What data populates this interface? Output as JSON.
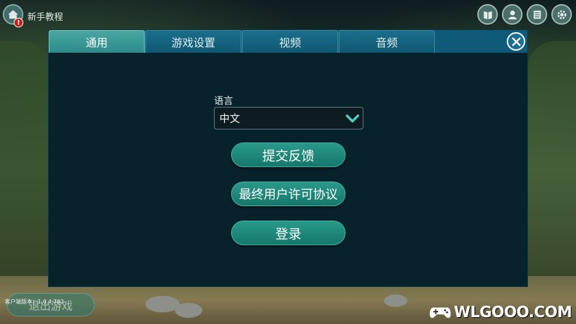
{
  "top_bar": {
    "title": "新手教程",
    "alert_badge": "!",
    "icons": [
      "book-icon",
      "profile-icon",
      "list-icon",
      "settings-gear-icon"
    ]
  },
  "dialog": {
    "tabs": [
      {
        "label": "通用",
        "active": true
      },
      {
        "label": "游戏设置",
        "active": false
      },
      {
        "label": "视频",
        "active": false
      },
      {
        "label": "音频",
        "active": false
      }
    ],
    "language": {
      "label": "语言",
      "selected": "中文"
    },
    "buttons": {
      "feedback": "提交反馈",
      "eula": "最终用户许可协议",
      "login": "登录"
    }
  },
  "bottom": {
    "exit_label": "退出游戏",
    "version": "客户端版本：1.0.4.702"
  },
  "watermark": "WLGOOO.COM",
  "colors": {
    "tab_active": "#2c8c8a",
    "tab_inactive": "#0f5873",
    "button_accent": "#16786b",
    "dialog_bg": "#08222b"
  }
}
